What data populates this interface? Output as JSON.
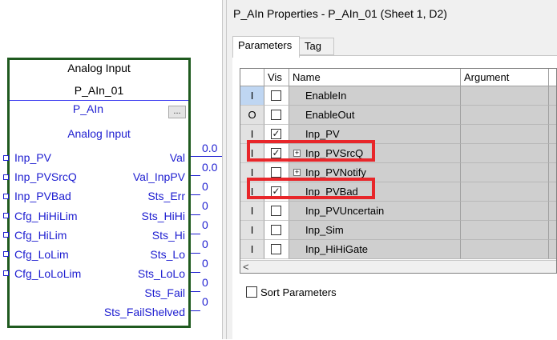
{
  "function_block": {
    "header_title": "Analog Input",
    "tag_name": "P_AIn_01",
    "type_name": "P_AIn",
    "more_button": "...",
    "subtitle": "Analog Input",
    "inputs": [
      "Inp_PV",
      "Inp_PVSrcQ",
      "Inp_PVBad",
      "Cfg_HiHiLim",
      "Cfg_HiLim",
      "Cfg_LoLim",
      "Cfg_LoLoLim"
    ],
    "outputs": [
      {
        "name": "Val",
        "value": "0.0"
      },
      {
        "name": "Val_InpPV",
        "value": "0.0"
      },
      {
        "name": "Sts_Err",
        "value": "0"
      },
      {
        "name": "Sts_HiHi",
        "value": "0"
      },
      {
        "name": "Sts_Hi",
        "value": "0"
      },
      {
        "name": "Sts_Lo",
        "value": "0"
      },
      {
        "name": "Sts_LoLo",
        "value": "0"
      },
      {
        "name": "Sts_Fail",
        "value": "0"
      },
      {
        "name": "Sts_FailShelved",
        "value": "0"
      }
    ]
  },
  "dialog": {
    "title": "P_AIn Properties - P_AIn_01 (Sheet 1, D2)",
    "tabs": [
      "Parameters",
      "Tag"
    ],
    "columns": [
      "",
      "Vis",
      "Name",
      "Argument"
    ],
    "rows": [
      {
        "io": "I",
        "vis": false,
        "name": "EnableIn",
        "expandable": false,
        "highlight": false,
        "selected": true
      },
      {
        "io": "O",
        "vis": false,
        "name": "EnableOut",
        "expandable": false,
        "highlight": false,
        "selected": false
      },
      {
        "io": "I",
        "vis": true,
        "name": "Inp_PV",
        "expandable": false,
        "highlight": false,
        "selected": false
      },
      {
        "io": "I",
        "vis": true,
        "name": "Inp_PVSrcQ",
        "expandable": true,
        "highlight": true,
        "selected": false
      },
      {
        "io": "I",
        "vis": false,
        "name": "Inp_PVNotify",
        "expandable": true,
        "highlight": false,
        "selected": false
      },
      {
        "io": "I",
        "vis": true,
        "name": "Inp_PVBad",
        "expandable": false,
        "highlight": true,
        "selected": false
      },
      {
        "io": "I",
        "vis": false,
        "name": "Inp_PVUncertain",
        "expandable": false,
        "highlight": false,
        "selected": false
      },
      {
        "io": "I",
        "vis": false,
        "name": "Inp_Sim",
        "expandable": false,
        "highlight": false,
        "selected": false
      },
      {
        "io": "I",
        "vis": false,
        "name": "Inp_HiHiGate",
        "expandable": false,
        "highlight": false,
        "selected": false
      }
    ],
    "scroll_left": "<",
    "sort_label": "Sort Parameters",
    "sort_checked": false,
    "highlight_color": "#e8262a"
  }
}
